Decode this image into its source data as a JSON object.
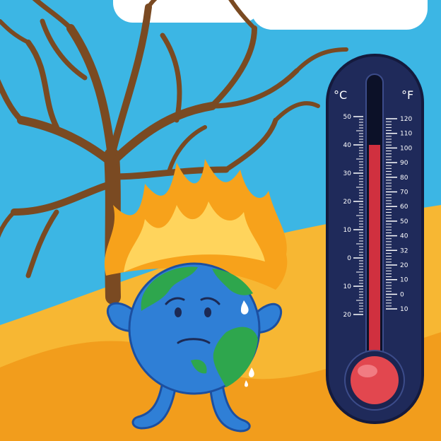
{
  "scene": {
    "colors": {
      "sky": "#3cb6e4",
      "cloud": "#ffffff",
      "desert_light": "#f7b733",
      "desert_dark": "#f29d1c",
      "tree": "#7a4a22",
      "flame_outer": "#f7a21b",
      "flame_inner": "#ffd45c",
      "earth_ocean": "#2f7fd6",
      "earth_land": "#2ea64d",
      "earth_outline": "#1c4fa0",
      "thermo_body": "#1f2a5a",
      "thermo_mercury": "#d0303f",
      "thermo_bulb": "#e2474f"
    },
    "icons": {
      "tree": "dead-tree-icon",
      "earth": "sad-earth-icon",
      "fire": "fire-icon",
      "thermometer": "thermometer-icon"
    }
  },
  "thermometer": {
    "celsius_label": "°C",
    "fahrenheit_label": "°F",
    "celsius_ticks": [
      {
        "label": "50"
      },
      {
        "label": "40"
      },
      {
        "label": "30"
      },
      {
        "label": "20"
      },
      {
        "label": "10"
      },
      {
        "label": "0"
      },
      {
        "label": "10"
      },
      {
        "label": "20"
      }
    ],
    "fahrenheit_ticks": [
      {
        "label": "120"
      },
      {
        "label": "110"
      },
      {
        "label": "100"
      },
      {
        "label": "90"
      },
      {
        "label": "80"
      },
      {
        "label": "70"
      },
      {
        "label": "60"
      },
      {
        "label": "50"
      },
      {
        "label": "40"
      },
      {
        "label": "32"
      },
      {
        "label": "20"
      },
      {
        "label": "10"
      },
      {
        "label": "0"
      },
      {
        "label": "10"
      }
    ],
    "mercury_top_celsius": 40
  }
}
